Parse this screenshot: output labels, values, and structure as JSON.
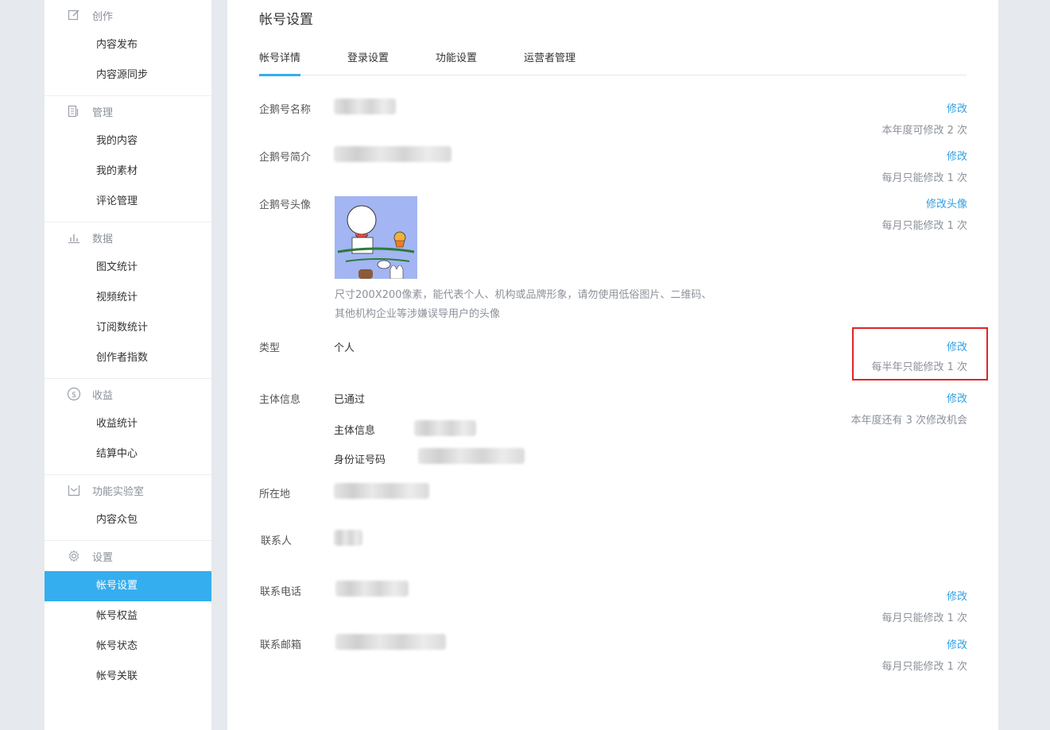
{
  "sidebar": {
    "groups": [
      {
        "title": "创作",
        "icon": "edit-icon",
        "items": [
          "内容发布",
          "内容源同步"
        ]
      },
      {
        "title": "管理",
        "icon": "document-icon",
        "items": [
          "我的内容",
          "我的素材",
          "评论管理"
        ]
      },
      {
        "title": "数据",
        "icon": "bar-chart-icon",
        "items": [
          "图文统计",
          "视频统计",
          "订阅数统计",
          "创作者指数"
        ]
      },
      {
        "title": "收益",
        "icon": "dollar-icon",
        "items": [
          "收益统计",
          "结算中心"
        ]
      },
      {
        "title": "功能实验室",
        "icon": "lab-icon",
        "items": [
          "内容众包"
        ]
      },
      {
        "title": "设置",
        "icon": "gear-icon",
        "items": [
          "帐号设置",
          "帐号权益",
          "帐号状态",
          "帐号关联"
        ],
        "active": "帐号设置"
      }
    ]
  },
  "main": {
    "title": "帐号设置",
    "tabs": [
      "帐号详情",
      "登录设置",
      "功能设置",
      "运营者管理"
    ],
    "active_tab": "帐号详情",
    "rows": {
      "name": {
        "label": "企鹅号名称",
        "action": "修改",
        "note": "本年度可修改 2 次"
      },
      "intro": {
        "label": "企鹅号简介",
        "action": "修改",
        "note": "每月只能修改 1 次"
      },
      "avatar": {
        "label": "企鹅号头像",
        "action": "修改头像",
        "note": "每月只能修改 1 次",
        "hint_line1": "尺寸200X200像素，能代表个人、机构或品牌形象，请勿使用低俗图片、二维码、",
        "hint_line2": "其他机构企业等涉嫌误导用户的头像"
      },
      "type": {
        "label": "类型",
        "value": "个人",
        "action": "修改",
        "note": "每半年只能修改 1 次"
      },
      "subject": {
        "label": "主体信息",
        "value": "已通过",
        "action": "修改",
        "note": "本年度还有 3 次修改机会",
        "sub1": "主体信息",
        "sub2": "身份证号码"
      },
      "location": {
        "label": "所在地"
      },
      "contact": {
        "label": "联系人"
      },
      "phone": {
        "label": "联系电话",
        "action": "修改",
        "note": "每月只能修改 1 次"
      },
      "email": {
        "label": "联系邮箱",
        "action": "修改",
        "note": "每月只能修改 1 次"
      }
    }
  },
  "colors": {
    "accent": "#35aef0",
    "link": "#2e9fe3",
    "highlight": "#e02525"
  }
}
